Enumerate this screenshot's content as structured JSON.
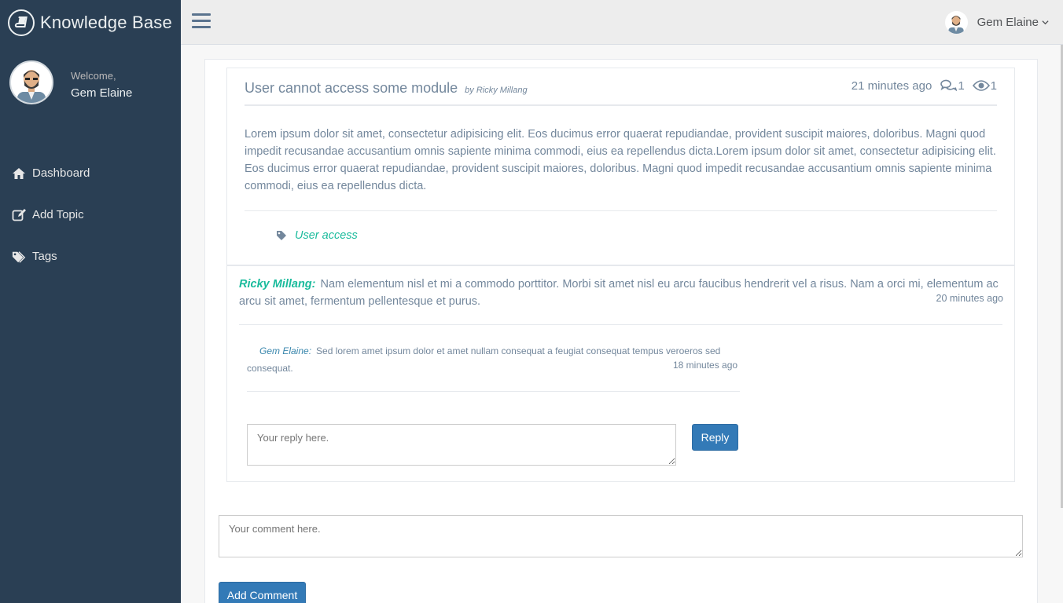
{
  "app": {
    "brand_title": "Knowledge Base",
    "brand_icon": "book-icon"
  },
  "sidebar": {
    "welcome": "Welcome,",
    "user_name": "Gem Elaine",
    "items": [
      {
        "label": "Dashboard",
        "icon": "home-icon"
      },
      {
        "label": "Add Topic",
        "icon": "edit-icon"
      },
      {
        "label": "Tags",
        "icon": "tags-icon"
      }
    ]
  },
  "topnav": {
    "user_name": "Gem Elaine",
    "menu_icon": "hamburger-icon"
  },
  "topic": {
    "title": "User cannot access some module",
    "by": "by Ricky Millang",
    "time": "21 minutes ago",
    "comment_count": "1",
    "view_count": "1",
    "body": "Lorem ipsum dolor sit amet, consectetur adipisicing elit. Eos ducimus error quaerat repudiandae, provident suscipit maiores, doloribus. Magni quod impedit recusandae accusantium omnis sapiente minima commodi, eius ea repellendus dicta.Lorem ipsum dolor sit amet, consectetur adipisicing elit. Eos ducimus error quaerat repudiandae, provident suscipit maiores, doloribus. Magni quod impedit recusandae accusantium omnis sapiente minima commodi, eius ea repellendus dicta.",
    "tag": "User access"
  },
  "comment": {
    "author": "Ricky Millang:",
    "text": "Nam elementum nisl et mi a commodo porttitor. Morbi sit amet nisl eu arcu faucibus hendrerit vel a risus. Nam a orci mi, elementum ac arcu sit amet, fermentum pellentesque et purus.",
    "time": "20 minutes ago",
    "reply": {
      "author": "Gem Elaine:",
      "text": "Sed lorem amet ipsum dolor et amet nullam consequat a feugiat consequat tempus veroeros sed consequat.",
      "time": "18 minutes ago"
    },
    "reply_placeholder": "Your reply here.",
    "reply_button": "Reply"
  },
  "new_comment": {
    "placeholder": "Your comment here.",
    "button": "Add Comment"
  },
  "colors": {
    "sidebar": "#2a3f54",
    "accent": "#1abb9c",
    "button": "#337ab7",
    "text": "#73879c"
  }
}
